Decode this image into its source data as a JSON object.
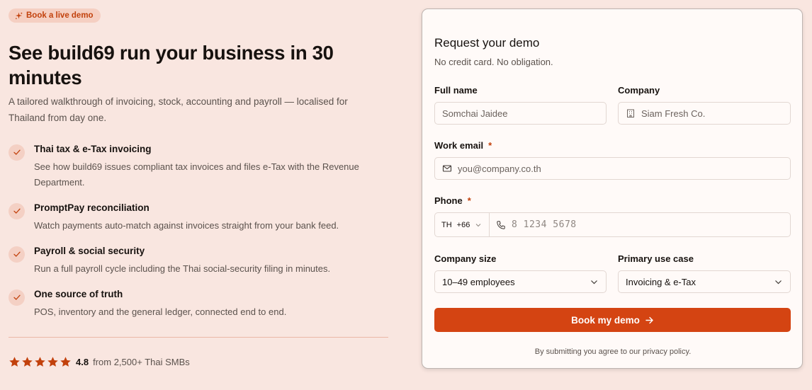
{
  "hero": {
    "badge": "Book a live demo",
    "title": "See build69 run your business in 30 minutes",
    "subtitle": "A tailored walkthrough of invoicing, stock, accounting and payroll — localised for Thailand from day one."
  },
  "features": [
    {
      "title": "Thai tax & e-Tax invoicing",
      "description": "See how build69 issues compliant tax invoices and files e-Tax with the Revenue Department."
    },
    {
      "title": "PromptPay reconciliation",
      "description": "Watch payments auto-match against invoices straight from your bank feed."
    },
    {
      "title": "Payroll & social security",
      "description": "Run a full payroll cycle including the Thai social-security filing in minutes."
    },
    {
      "title": "One source of truth",
      "description": "POS, inventory and the general ledger, connected end to end."
    }
  ],
  "rating": {
    "stars": 5,
    "score": "4.8",
    "text": "from 2,500+ Thai SMBs"
  },
  "form": {
    "title": "Request your demo",
    "subtitle": "No credit card. No obligation.",
    "full_name": {
      "label": "Full name",
      "placeholder": "Somchai Jaidee"
    },
    "company": {
      "label": "Company",
      "placeholder": "Siam Fresh Co."
    },
    "email": {
      "label": "Work email",
      "required": "*",
      "placeholder": "you@company.co.th"
    },
    "phone": {
      "label": "Phone",
      "required": "*",
      "country_code": "TH",
      "dial_code": "+66",
      "placeholder": "8 1234 5678"
    },
    "company_size": {
      "label": "Company size",
      "value": "10–49 employees"
    },
    "use_case": {
      "label": "Primary use case",
      "value": "Invoicing & e-Tax"
    },
    "submit_label": "Book my demo",
    "legal": "By submitting you agree to our privacy policy."
  },
  "colors": {
    "background": "#f9e6e0",
    "accent": "#d44412",
    "badge_bg": "#f5cfc2",
    "star": "#c2410c"
  }
}
